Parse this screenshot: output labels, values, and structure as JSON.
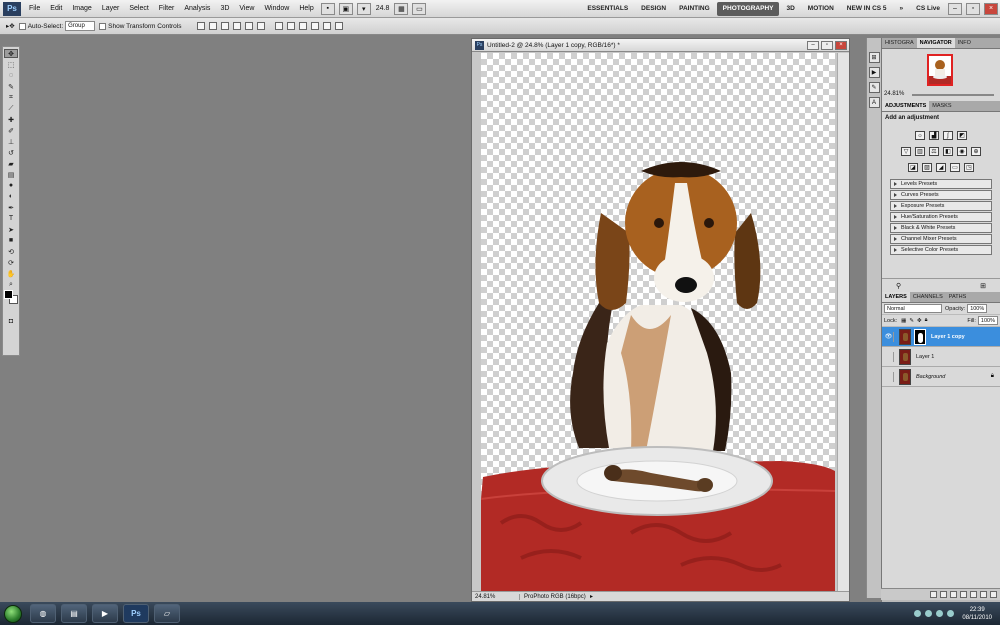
{
  "app": {
    "logo": "Ps"
  },
  "menu": [
    "File",
    "Edit",
    "Image",
    "Layer",
    "Select",
    "Filter",
    "Analysis",
    "3D",
    "View",
    "Window",
    "Help"
  ],
  "menubar": {
    "zoom": "24.8"
  },
  "workspaces": [
    "ESSENTIALS",
    "DESIGN",
    "PAINTING",
    "PHOTOGRAPHY",
    "3D",
    "MOTION",
    "NEW IN CS 5"
  ],
  "cslive": "CS Live",
  "options": {
    "auto_select": "Auto-Select:",
    "auto_select_value": "Group",
    "transform": "Show Transform Controls"
  },
  "document": {
    "title": "Untitled-2 @ 24.8% (Layer 1 copy, RGB/16*) *",
    "zoom": "24.81%",
    "profile": "ProPhoto RGB (16bpc)"
  },
  "panels": {
    "top_tabs": [
      "HISTOGRA",
      "NAVIGATOR",
      "INFO"
    ],
    "nav_zoom": "24.81%",
    "adj_tabs": [
      "ADJUSTMENTS",
      "MASKS"
    ],
    "adj_title": "Add an adjustment",
    "presets": [
      "Levels Presets",
      "Curves Presets",
      "Exposure Presets",
      "Hue/Saturation Presets",
      "Black & White Presets",
      "Channel Mixer Presets",
      "Selective Color Presets"
    ],
    "layer_tabs": [
      "LAYERS",
      "CHANNELS",
      "PATHS"
    ],
    "blend_mode": "Normal",
    "opacity_label": "Opacity:",
    "opacity": "100%",
    "lock_label": "Lock:",
    "fill_label": "Fill:",
    "fill": "100%",
    "layers": [
      "Layer 1 copy",
      "Layer 1",
      "Background"
    ]
  },
  "taskbar": {
    "time": "22:39",
    "date": "08/11/2010"
  }
}
